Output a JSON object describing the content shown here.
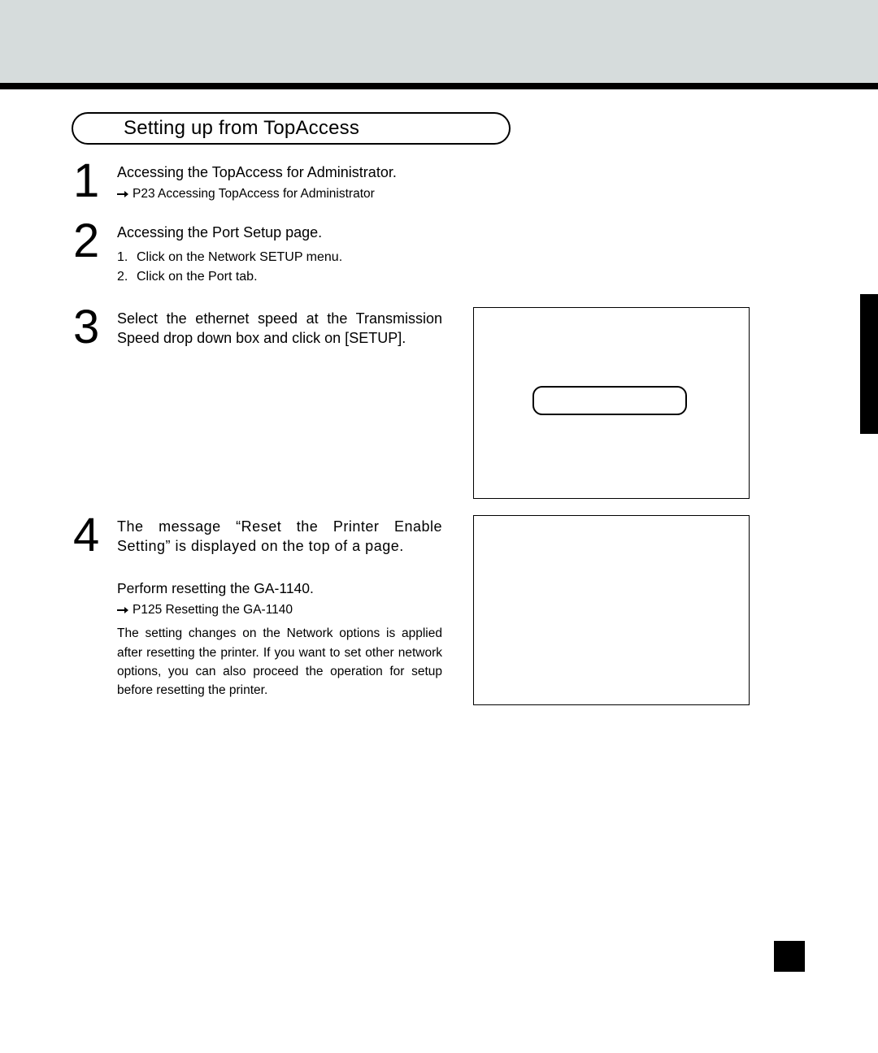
{
  "section_heading": "Setting up from TopAccess",
  "steps": [
    {
      "num": "1",
      "title": "Accessing the TopAccess for Administrator.",
      "ref": "P23  Accessing TopAccess for Administrator"
    },
    {
      "num": "2",
      "title": "Accessing the Port Setup page.",
      "items": [
        "Click on the Network SETUP menu.",
        "Click on the Port tab."
      ]
    },
    {
      "num": "3",
      "title": "Select the ethernet speed at the Transmission Speed drop down box and click on [SETUP]."
    },
    {
      "num": "4",
      "title": "The message “Reset the Printer Enable Setting” is displayed on the top of a page.",
      "extra_title": "Perform resetting the GA-1140.",
      "ref": "P125  Resetting the GA-1140",
      "note": "The setting changes on the Network options is applied after resetting the printer. If you want to set other network options, you can also proceed the operation for setup before resetting the printer."
    }
  ],
  "sublist_numbers": [
    "1.",
    "2."
  ]
}
